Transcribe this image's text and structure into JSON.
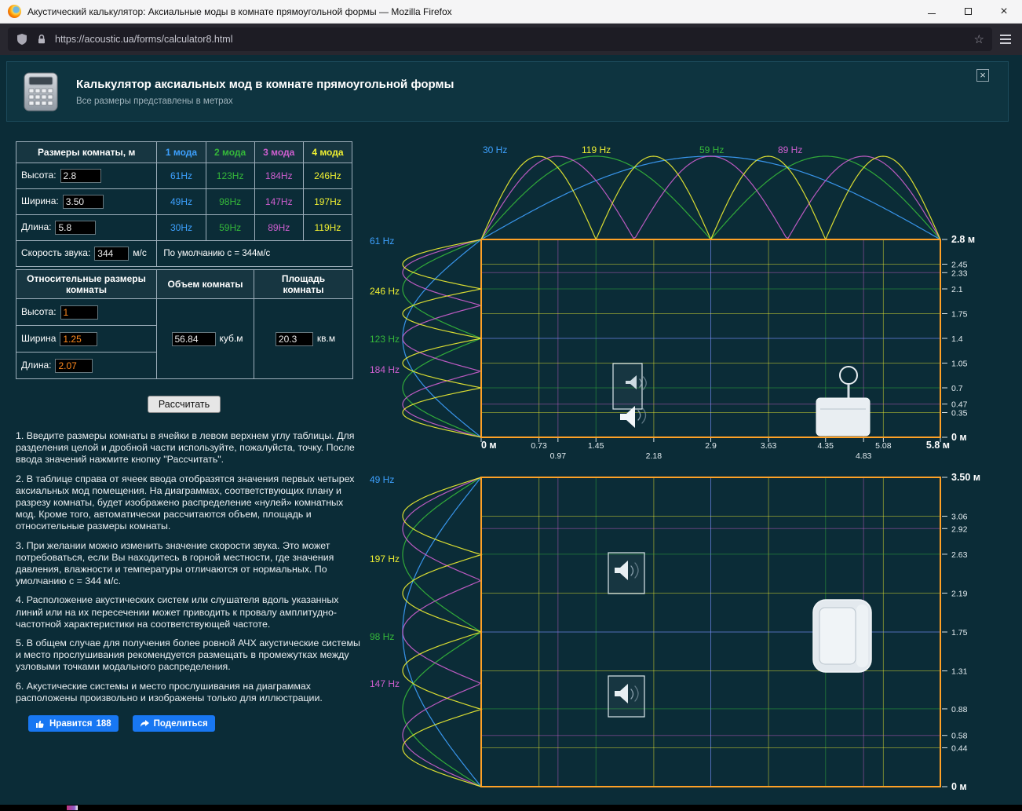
{
  "browser": {
    "title": "Акустический калькулятор: Аксиальные моды в комнате прямоугольной формы — Mozilla Firefox",
    "url": "https://acoustic.ua/forms/calculator8.html"
  },
  "page_header": {
    "title": "Калькулятор аксиальных мод в комнате прямоугольной формы",
    "subtitle": "Все размеры представлены в метрах"
  },
  "tables": {
    "dimensions": {
      "title": "Размеры комнаты, м",
      "mode_headers": [
        "1 мода",
        "2 мода",
        "3 мода",
        "4 мода"
      ],
      "rows": [
        {
          "label": "Высота:",
          "value": "2.8",
          "modes": [
            "61Hz",
            "123Hz",
            "184Hz",
            "246Hz"
          ]
        },
        {
          "label": "Ширина:",
          "value": "3.50",
          "modes": [
            "49Hz",
            "98Hz",
            "147Hz",
            "197Hz"
          ]
        },
        {
          "label": "Длина:",
          "value": "5.8",
          "modes": [
            "30Hz",
            "59Hz",
            "89Hz",
            "119Hz"
          ]
        }
      ],
      "speed_label": "Скорость звука:",
      "speed_value": "344",
      "speed_unit": "м/с",
      "speed_note": "По  умолчанию с = 344м/с"
    },
    "secondary": {
      "headers": [
        "Относительные размеры комнаты",
        "Объем комнаты",
        "Площадь комнаты"
      ],
      "relative_rows": [
        {
          "label": "Высота:",
          "value": "1"
        },
        {
          "label": "Ширина",
          "value": "1.25"
        },
        {
          "label": "Длина:",
          "value": "2.07"
        }
      ],
      "volume_value": "56.84",
      "volume_unit": "куб.м",
      "area_value": "20.3",
      "area_unit": "кв.м"
    }
  },
  "calc_button_label": "Рассчитать",
  "instructions": [
    "1. Введите размеры комнаты в ячейки в левом верхнем углу таблицы. Для разделения целой и дробной части используйте, пожалуйста, точку. После ввода значений нажмите кнопку \"Рассчитать\".",
    "2. В таблице справа от ячеек ввода отобразятся значения первых четырех аксиальных мод помещения. На диаграммах, соответствующих плану и разрезу комнаты, будет изображено распределение «нулей» комнатных мод. Кроме того, автоматически рассчитаются объем, площадь и относительные размеры комнаты.",
    "3. При желании можно изменить значение скорости звука. Это может потребоваться, если Вы находитесь в горной местности, где значения давления, влажности и температуры отличаются от нормальных. По умолчанию с = 344 м/с.",
    "4. Расположение акустических систем или слушателя вдоль указанных линий или на их пересечении может приводить к провалу амплитудно-частотной характеристики на соответствующей частоте.",
    "5. В общем случае для получения более ровной АЧХ акустические системы и место прослушивания рекомендуется размещать в промежутках между узловыми точками модального распределения.",
    "6. Акустические системы и место прослушивания на диаграммах расположены произвольно и изображены только для иллюстрации."
  ],
  "fb": {
    "like_label": "Нравится",
    "like_count": "188",
    "share_label": "Поделиться"
  },
  "chart_data": [
    {
      "type": "line",
      "title": "Разрез комнаты — распределение нулей аксиальных мод",
      "room_length_m": 5.8,
      "room_height_m": 2.8,
      "length_modes": [
        {
          "mode": 1,
          "freq_label": "30 Hz",
          "color": "#3da1ff",
          "nodes_m": [
            2.9
          ]
        },
        {
          "mode": 2,
          "freq_label": "59 Hz",
          "color": "#35b83a",
          "nodes_m": [
            1.45,
            4.35
          ]
        },
        {
          "mode": 3,
          "freq_label": "89 Hz",
          "color": "#cf5fd0",
          "nodes_m": [
            0.97,
            2.9,
            4.83
          ]
        },
        {
          "mode": 4,
          "freq_label": "119 Hz",
          "color": "#f0f032",
          "nodes_m": [
            0.73,
            2.18,
            3.63,
            5.08
          ]
        }
      ],
      "height_modes": [
        {
          "mode": 1,
          "freq_label": "61 Hz",
          "color": "#3da1ff",
          "nodes_m": [
            1.4
          ]
        },
        {
          "mode": 2,
          "freq_label": "123 Hz",
          "color": "#35b83a",
          "nodes_m": [
            0.7,
            2.1
          ]
        },
        {
          "mode": 3,
          "freq_label": "184 Hz",
          "color": "#cf5fd0",
          "nodes_m": [
            0.47,
            1.4,
            2.33
          ]
        },
        {
          "mode": 4,
          "freq_label": "246 Hz",
          "color": "#f0f032",
          "nodes_m": [
            0.35,
            1.05,
            1.75,
            2.45
          ]
        }
      ],
      "top_labels": [
        "30 Hz",
        "119 Hz",
        "59 Hz",
        "89 Hz"
      ],
      "left_labels": [
        "61 Hz",
        "246 Hz",
        "123 Hz",
        "184 Hz"
      ],
      "x_axis_labels": [
        "0 м",
        "0.73",
        "0.97",
        "1.45",
        "2.18",
        "2.9",
        "3.63",
        "4.35",
        "4.83",
        "5.08",
        "5.8 м"
      ],
      "y_axis_labels": [
        "2.8 м",
        "2.45",
        "2.33",
        "2.1",
        "1.75",
        "1.4",
        "1.05",
        "0.7",
        "0.47",
        "0.35",
        "0 м"
      ]
    },
    {
      "type": "line",
      "title": "План комнаты — распределение нулей аксиальных мод",
      "room_length_m": 5.8,
      "room_width_m": 3.5,
      "width_modes": [
        {
          "mode": 1,
          "freq_label": "49 Hz",
          "color": "#3da1ff",
          "nodes_m": [
            1.75
          ]
        },
        {
          "mode": 2,
          "freq_label": "98 Hz",
          "color": "#35b83a",
          "nodes_m": [
            0.88,
            2.63
          ]
        },
        {
          "mode": 3,
          "freq_label": "147 Hz",
          "color": "#cf5fd0",
          "nodes_m": [
            0.58,
            1.75,
            2.92
          ]
        },
        {
          "mode": 4,
          "freq_label": "197 Hz",
          "color": "#f0f032",
          "nodes_m": [
            0.44,
            1.31,
            2.19,
            3.06
          ]
        }
      ],
      "left_labels": [
        "49 Hz",
        "197 Hz",
        "98 Hz",
        "147 Hz"
      ],
      "y_axis_labels": [
        "3.50 м",
        "3.06",
        "2.92",
        "2.63",
        "2.19",
        "1.75",
        "1.31",
        "0.88",
        "0.58",
        "0.44",
        "0 м"
      ]
    }
  ]
}
